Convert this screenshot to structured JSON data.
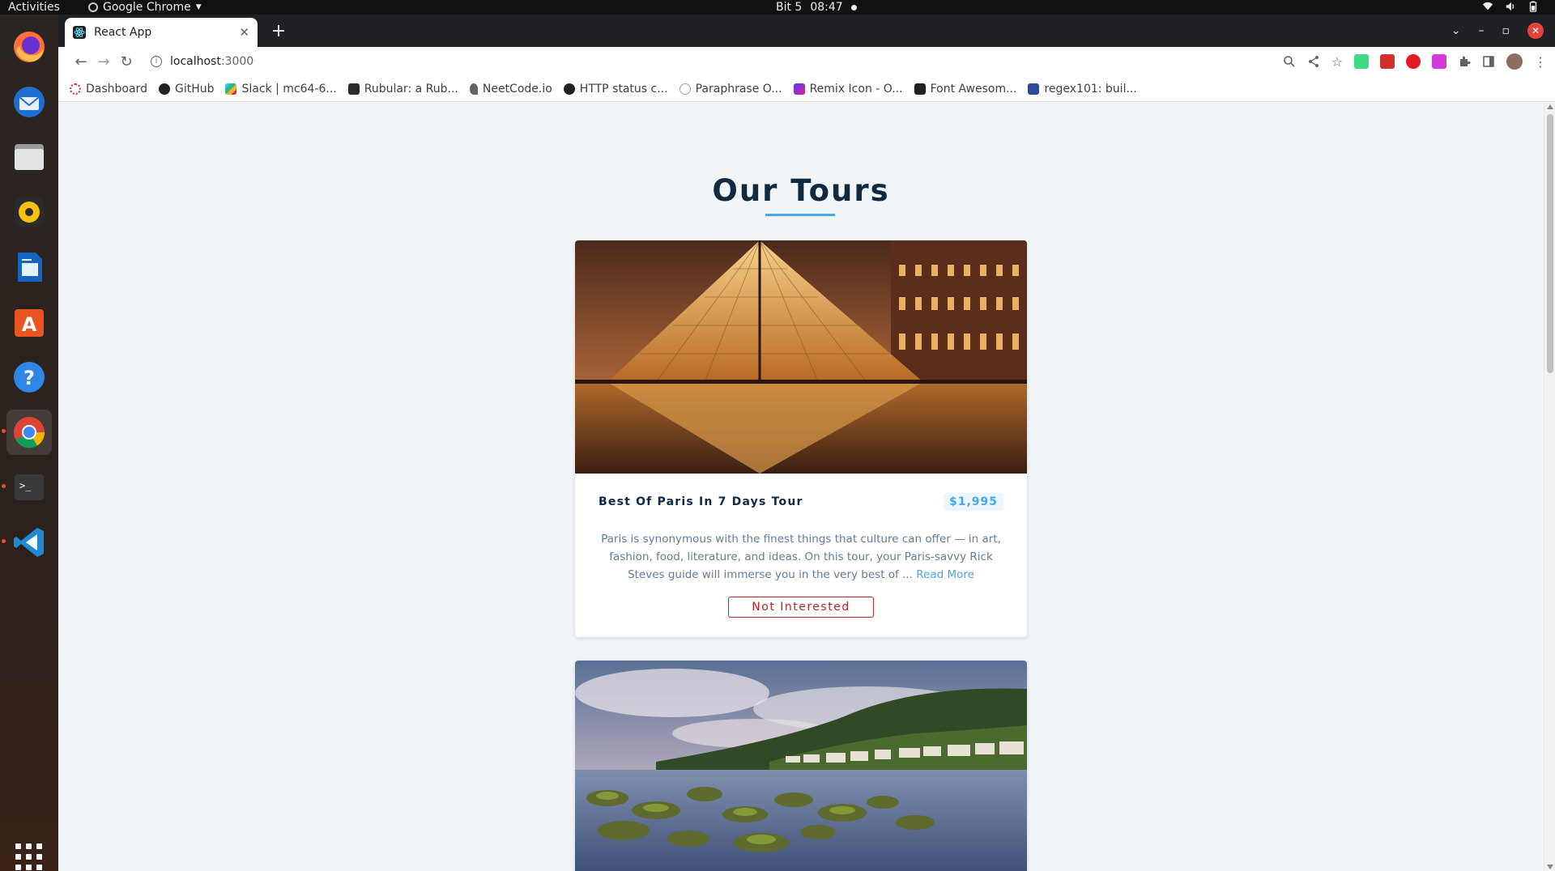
{
  "system": {
    "activities": "Activities",
    "app_menu": "Google Chrome",
    "clock_day": "Bit 5",
    "clock_time": "08:47"
  },
  "browser": {
    "tab_title": "React App",
    "url_host": "localhost",
    "url_port": ":3000",
    "bookmarks": [
      {
        "label": "Dashboard",
        "color": "#d93025"
      },
      {
        "label": "GitHub",
        "color": "#202124"
      },
      {
        "label": "Slack | mc64-6...",
        "color": "#36c5f0"
      },
      {
        "label": "Rubular: a Rub...",
        "color": "#2b2b2b"
      },
      {
        "label": "NeetCode.io",
        "color": "#5f6368"
      },
      {
        "label": "HTTP status c...",
        "color": "#202124"
      },
      {
        "label": "Paraphrase O...",
        "color": "#9aa0a6"
      },
      {
        "label": "Remix Icon - O...",
        "color": "#4a3aff"
      },
      {
        "label": "Font Awesom...",
        "color": "#202124"
      },
      {
        "label": "regex101: buil...",
        "color": "#2c4a9c"
      }
    ]
  },
  "page": {
    "title": "Our Tours",
    "accent_color": "#49a6e9",
    "tours": [
      {
        "name": "Best Of Paris In 7 Days Tour",
        "price": "$1,995",
        "info": "Paris is synonymous with the finest things that culture can offer — in art, fashion, food, literature, and ideas. On this tour, your Paris-savvy Rick Steves guide will immerse you in the very best of ...",
        "read_more": "Read More",
        "button": "Not Interested"
      }
    ]
  }
}
